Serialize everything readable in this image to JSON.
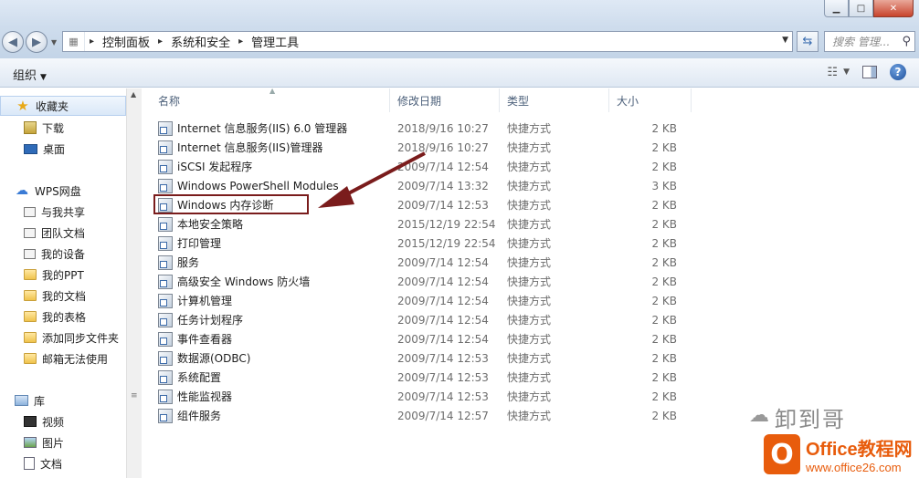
{
  "window": {
    "minimize": "▁",
    "maximize": "□",
    "close": "✕"
  },
  "address": {
    "crumbs": [
      "控制面板",
      "系统和安全",
      "管理工具"
    ],
    "search_placeholder": "搜索 管理..."
  },
  "toolbar": {
    "organize": "组织"
  },
  "sidebar": {
    "favorites": "收藏夹",
    "fav_items": [
      "下载",
      "桌面"
    ],
    "wps": "WPS网盘",
    "wps_items": [
      "与我共享",
      "团队文档",
      "我的设备",
      "我的PPT",
      "我的文档",
      "我的表格",
      "添加同步文件夹",
      "邮箱无法使用"
    ],
    "library": "库",
    "lib_items": [
      "视频",
      "图片",
      "文档"
    ]
  },
  "columns": {
    "name": "名称",
    "date": "修改日期",
    "type": "类型",
    "size": "大小"
  },
  "files": [
    {
      "name": "Internet 信息服务(IIS) 6.0 管理器",
      "date": "2018/9/16 10:27",
      "type": "快捷方式",
      "size": "2 KB"
    },
    {
      "name": "Internet 信息服务(IIS)管理器",
      "date": "2018/9/16 10:27",
      "type": "快捷方式",
      "size": "2 KB"
    },
    {
      "name": "iSCSI 发起程序",
      "date": "2009/7/14 12:54",
      "type": "快捷方式",
      "size": "2 KB"
    },
    {
      "name": "Windows PowerShell Modules",
      "date": "2009/7/14 13:32",
      "type": "快捷方式",
      "size": "3 KB"
    },
    {
      "name": "Windows 内存诊断",
      "date": "2009/7/14 12:53",
      "type": "快捷方式",
      "size": "2 KB"
    },
    {
      "name": "本地安全策略",
      "date": "2015/12/19 22:54",
      "type": "快捷方式",
      "size": "2 KB"
    },
    {
      "name": "打印管理",
      "date": "2015/12/19 22:54",
      "type": "快捷方式",
      "size": "2 KB"
    },
    {
      "name": "服务",
      "date": "2009/7/14 12:54",
      "type": "快捷方式",
      "size": "2 KB"
    },
    {
      "name": "高级安全 Windows 防火墙",
      "date": "2009/7/14 12:54",
      "type": "快捷方式",
      "size": "2 KB"
    },
    {
      "name": "计算机管理",
      "date": "2009/7/14 12:54",
      "type": "快捷方式",
      "size": "2 KB"
    },
    {
      "name": "任务计划程序",
      "date": "2009/7/14 12:54",
      "type": "快捷方式",
      "size": "2 KB"
    },
    {
      "name": "事件查看器",
      "date": "2009/7/14 12:54",
      "type": "快捷方式",
      "size": "2 KB"
    },
    {
      "name": "数据源(ODBC)",
      "date": "2009/7/14 12:53",
      "type": "快捷方式",
      "size": "2 KB"
    },
    {
      "name": "系统配置",
      "date": "2009/7/14 12:53",
      "type": "快捷方式",
      "size": "2 KB"
    },
    {
      "name": "性能监视器",
      "date": "2009/7/14 12:53",
      "type": "快捷方式",
      "size": "2 KB"
    },
    {
      "name": "组件服务",
      "date": "2009/7/14 12:57",
      "type": "快捷方式",
      "size": "2 KB"
    }
  ],
  "watermark": {
    "text": "卸到哥",
    "logo_mark": "O",
    "logo_line1": "Office教程网",
    "logo_line2": "www.office26.com"
  },
  "colors": {
    "annotation": "#7a1c1c",
    "logo": "#e85c0c"
  }
}
